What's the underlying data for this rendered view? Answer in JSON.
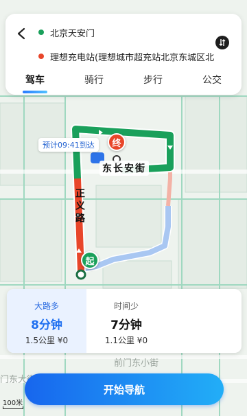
{
  "route_panel": {
    "start": "北京天安门",
    "end": "理想充电站(理想城市超充站北京东城区北",
    "tabs": [
      {
        "label": "驾车",
        "active": true
      },
      {
        "label": "骑行",
        "active": false
      },
      {
        "label": "步行",
        "active": false
      },
      {
        "label": "公交",
        "active": false
      }
    ]
  },
  "map": {
    "eta": "预计09:41到达",
    "road_horizontal": "东长安街",
    "road_vertical": "正义路",
    "street_label_1": "前门东小街",
    "street_label_2": "门东大街",
    "start_pin": "起",
    "end_pin": "终",
    "scale": "100米",
    "colors": {
      "congested": "#e8462a",
      "smooth": "#1aa05b",
      "alternate": "#a9c7f2",
      "start": "#1aa05b",
      "end": "#e8462a"
    }
  },
  "routes": [
    {
      "tag": "大路多",
      "duration": "8分钟",
      "meta": "1.5公里 ¥0",
      "selected": true
    },
    {
      "tag": "时间少",
      "duration": "7分钟",
      "meta": "1.1公里 ¥0",
      "selected": false
    }
  ],
  "nav_button": "开始导航"
}
